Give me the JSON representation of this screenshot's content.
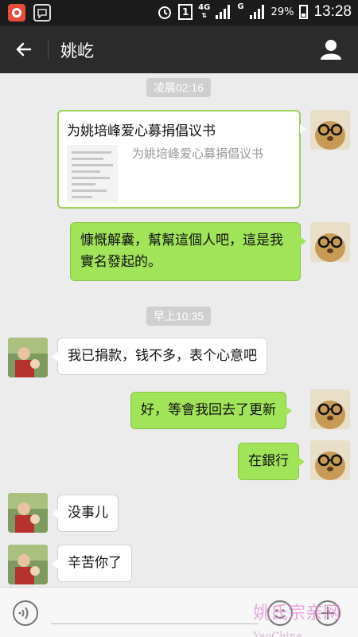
{
  "status_bar": {
    "time": "13:28",
    "battery": "29%",
    "network": "4G",
    "sim_slot": "1",
    "network_alt": "G"
  },
  "header": {
    "title": "姚屹",
    "back_icon": "arrow-left-icon",
    "profile_icon": "person-icon"
  },
  "chat": {
    "timestamps": [
      "凌晨02:16",
      "早上10:35"
    ],
    "share_card": {
      "title": "为姚培峰爱心募捐倡议书",
      "description": "为姚培峰爱心募捐倡议书"
    },
    "messages": [
      {
        "from": "me",
        "text": "慷慨解囊，幫幫這個人吧，這是我實名發起的。"
      },
      {
        "from": "other",
        "text": "我已捐款，钱不多，表个心意吧"
      },
      {
        "from": "me",
        "text": "好，等會我回去了更新"
      },
      {
        "from": "me",
        "text": "在銀行"
      },
      {
        "from": "other",
        "text": "没事儿"
      },
      {
        "from": "other",
        "text": "辛苦你了"
      }
    ]
  },
  "input_bar": {
    "voice_icon": "voice-icon",
    "emoji_icon": "smiley-icon",
    "plus_icon": "plus-icon"
  },
  "watermark": {
    "text": "姚氏宗亲网",
    "domain": "YaoChina"
  },
  "colors": {
    "my_bubble": "#a1e45a",
    "other_bubble": "#ffffff",
    "title_bar": "#2b2b2b",
    "status_bar": "#1b1b1b",
    "chat_bg": "#ececec"
  }
}
